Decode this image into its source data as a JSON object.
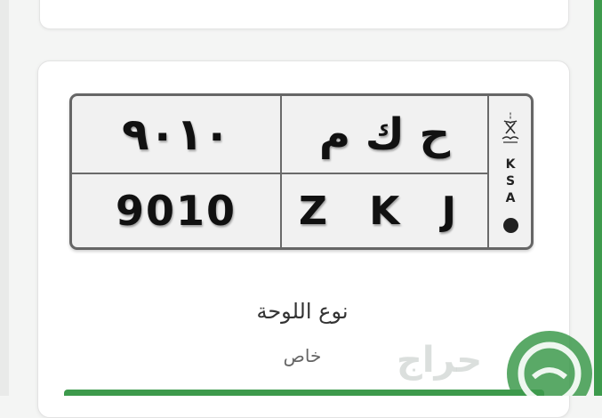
{
  "plate": {
    "arabic_numbers": "٩٠١٠",
    "arabic_letters": "ح ك م",
    "english_numbers": "9010",
    "english_letters": "Z K J",
    "country_code": "K S A"
  },
  "details": {
    "plate_type_label": "نوع اللوحة",
    "plate_type_value": "خاص"
  },
  "watermark": {
    "text": "حراج"
  },
  "colors": {
    "accent": "#3d9a4c",
    "plate_border": "#666666"
  },
  "icons": [
    "saudi-emblem-icon",
    "haraj-logo-icon"
  ]
}
